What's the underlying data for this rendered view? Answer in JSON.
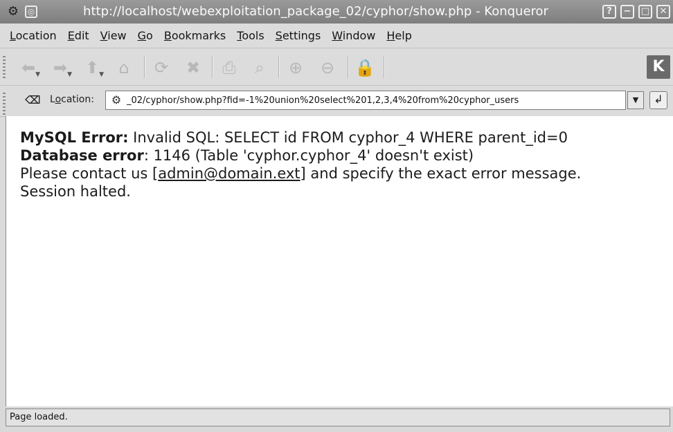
{
  "window": {
    "title": "http://localhost/webexploitation_package_02/cyphor/show.php - Konqueror",
    "app_icon": "konqueror-app-icon",
    "buttons": {
      "help": "?",
      "minimize": "−",
      "maximize": "□",
      "close": "✕"
    }
  },
  "menubar": {
    "items": [
      {
        "ul": "L",
        "rest": "ocation"
      },
      {
        "ul": "E",
        "rest": "dit"
      },
      {
        "ul": "V",
        "rest": "iew"
      },
      {
        "ul": "G",
        "rest": "o"
      },
      {
        "ul": "B",
        "rest": "ookmarks"
      },
      {
        "ul": "T",
        "rest": "ools"
      },
      {
        "ul": "S",
        "rest": "ettings"
      },
      {
        "ul": "W",
        "rest": "indow"
      },
      {
        "ul": "H",
        "rest": "elp"
      }
    ]
  },
  "toolbar": {
    "icons": [
      "back-icon",
      "forward-icon",
      "up-icon",
      "home-icon",
      "reload-icon",
      "stop-icon",
      "print-icon",
      "find-icon",
      "zoom-in-icon",
      "zoom-out-icon",
      "security-icon"
    ],
    "glyphs": {
      "back": "⬅",
      "forward": "➡",
      "up": "⬆",
      "home": "⌂",
      "reload": "⟳",
      "stop": "✖",
      "print": "⎙",
      "find": "⌕",
      "zoomin": "⊕",
      "zoomout": "⊖",
      "security": "🔒",
      "kde": "K"
    }
  },
  "location": {
    "label_ul": "o",
    "label_pre": "L",
    "label_post": "cation:",
    "value": "_02/cyphor/show.php?fid=-1%20union%20select%201,2,3,4%20from%20cyphor_users",
    "clear_glyph": "⌫",
    "go_glyph": "↲",
    "drop_glyph": "▼"
  },
  "page": {
    "line1_label": "MySQL Error:",
    "line1_text": " Invalid SQL: SELECT id FROM cyphor_4 WHERE parent_id=0",
    "line2_label": "Database error",
    "line2_text": ": 1146 (Table 'cyphor.cyphor_4' doesn't exist)",
    "line3_pre": "Please contact us [",
    "line3_link": "admin@domain.ext",
    "line3_post": "] and specify the exact error message.",
    "line4": "Session halted."
  },
  "status": {
    "text": "Page loaded."
  }
}
